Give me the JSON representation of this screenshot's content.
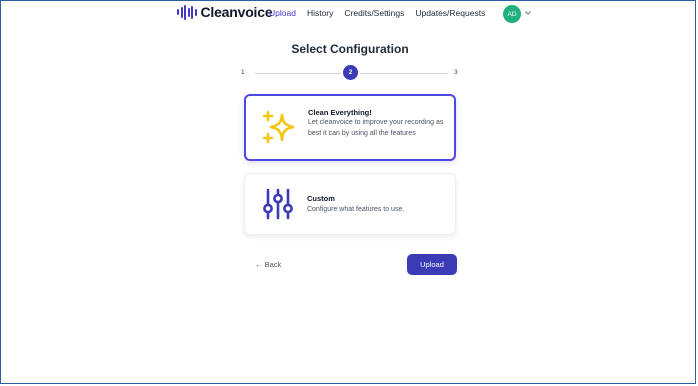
{
  "header": {
    "brand": "Cleanvoice",
    "nav": [
      "Upload",
      "History",
      "Credits/Settings",
      "Updates/Requests"
    ],
    "active_nav": "Upload",
    "avatar_initials": "AD"
  },
  "page": {
    "title": "Select Configuration"
  },
  "stepper": {
    "steps": [
      "1",
      "2",
      "3"
    ],
    "current": "2"
  },
  "options": [
    {
      "title": "Clean Everything!",
      "description": "Let cleanvoice to improve your recording as best it can by using all the features",
      "icon": "sparkles-icon",
      "selected": true
    },
    {
      "title": "Custom",
      "description": "Configure what features to use.",
      "icon": "sliders-icon",
      "selected": false
    }
  ],
  "actions": {
    "back_label": "← Back",
    "upload_label": "Upload"
  },
  "colors": {
    "accent": "#4338ca",
    "selected_border": "#4f46e5",
    "sparkle": "#f5c518",
    "avatar": "#22b07d",
    "frame_border": "#2b5fa0"
  }
}
